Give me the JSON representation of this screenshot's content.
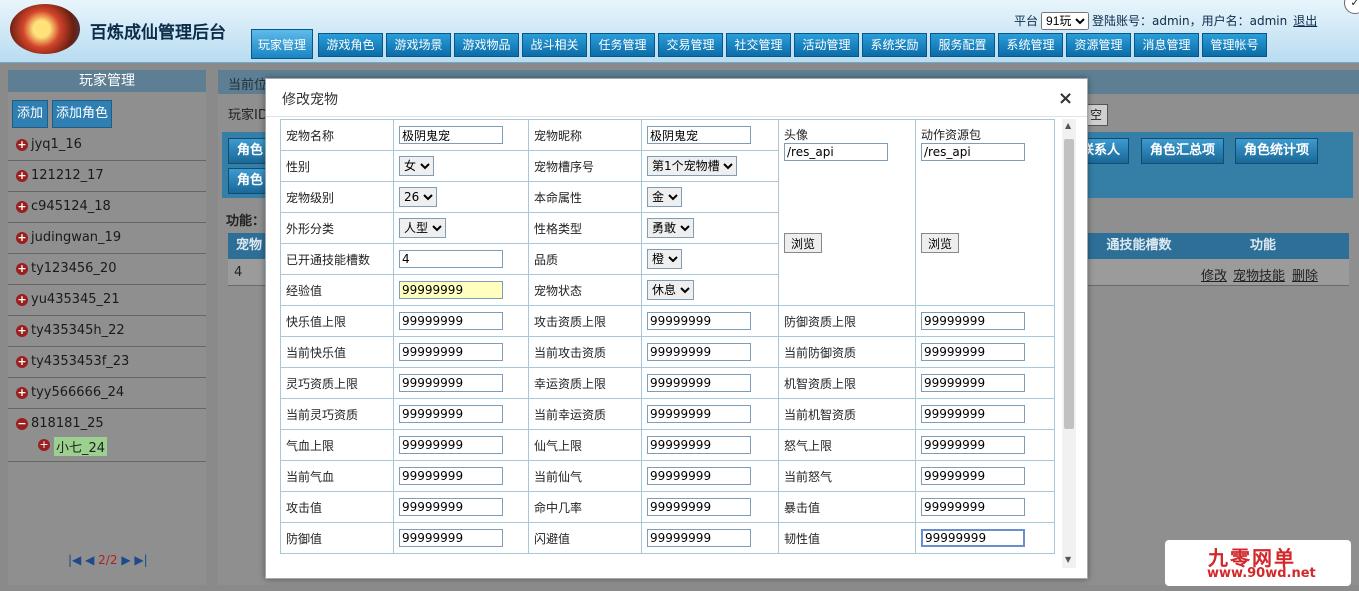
{
  "header": {
    "app_title": "百炼成仙管理后台",
    "platform_label": "平台",
    "platform_value": "91玩",
    "login_account_text": "登陆账号：admin，用户名：admin",
    "logout": "退出"
  },
  "nav": [
    {
      "label": "玩家管理",
      "active": true
    },
    {
      "label": "游戏角色"
    },
    {
      "label": "游戏场景"
    },
    {
      "label": "游戏物品"
    },
    {
      "label": "战斗相关"
    },
    {
      "label": "任务管理"
    },
    {
      "label": "交易管理"
    },
    {
      "label": "社交管理"
    },
    {
      "label": "活动管理"
    },
    {
      "label": "系统奖励"
    },
    {
      "label": "服务配置"
    },
    {
      "label": "系统管理"
    },
    {
      "label": "资源管理"
    },
    {
      "label": "消息管理"
    },
    {
      "label": "管理帐号"
    }
  ],
  "sidebar": {
    "title": "玩家管理",
    "add": "添加",
    "add_role": "添加角色",
    "players": [
      "jyq1_16",
      "121212_17",
      "c945124_18",
      "judingwan_19",
      "ty123456_20",
      "yu435345_21",
      "ty435345h_22",
      "ty4353453f_23",
      "tyy566666_24",
      "818181_25"
    ],
    "pet": "小七_24",
    "pager": "2/2"
  },
  "main": {
    "crumb": "当前位",
    "player_id_label": "玩家ID",
    "clear": "空",
    "tabs": [
      "角色",
      "联系人",
      "角色汇总项",
      "角色统计项",
      "角色"
    ],
    "func_label": "功能：",
    "table_headers": [
      "宠物",
      "通技能槽数",
      "功能"
    ],
    "row": {
      "id": "4",
      "edit": "修改",
      "pet_skill": "宠物技能",
      "delete": "删除"
    }
  },
  "modal": {
    "title": "修改宠物",
    "close": "×",
    "fields": {
      "pet_name_label": "宠物名称",
      "pet_name": "极阴鬼宠",
      "nickname_label": "宠物昵称",
      "nickname": "极阴鬼宠",
      "avatar_label": "头像",
      "avatar": "/res_api",
      "action_pack_label": "动作资源包",
      "action_pack": "/res_api",
      "browse": "浏览",
      "gender_label": "性别",
      "gender": "女",
      "slot_label": "宠物槽序号",
      "slot": "第1个宠物槽",
      "level_label": "宠物级别",
      "level": "26",
      "element_label": "本命属性",
      "element": "金",
      "shape_label": "外形分类",
      "shape": "人型",
      "character_label": "性格类型",
      "character": "勇敢",
      "skill_slots_label": "已开通技能槽数",
      "skill_slots": "4",
      "quality_label": "品质",
      "quality": "橙",
      "exp_label": "经验值",
      "exp": "99999999",
      "state_label": "宠物状态",
      "state": "休息"
    },
    "grid": [
      [
        "快乐值上限",
        "99999999",
        "攻击资质上限",
        "99999999",
        "防御资质上限",
        "99999999"
      ],
      [
        "当前快乐值",
        "99999999",
        "当前攻击资质",
        "99999999",
        "当前防御资质",
        "99999999"
      ],
      [
        "灵巧资质上限",
        "99999999",
        "幸运资质上限",
        "99999999",
        "机智资质上限",
        "99999999"
      ],
      [
        "当前灵巧资质",
        "99999999",
        "当前幸运资质",
        "99999999",
        "当前机智资质",
        "99999999"
      ],
      [
        "气血上限",
        "99999999",
        "仙气上限",
        "99999999",
        "怒气上限",
        "99999999"
      ],
      [
        "当前气血",
        "99999999",
        "当前仙气",
        "99999999",
        "当前怒气",
        "99999999"
      ],
      [
        "攻击值",
        "99999999",
        "命中几率",
        "99999999",
        "暴击值",
        "99999999"
      ],
      [
        "防御值",
        "99999999",
        "闪避值",
        "99999999",
        "韧性值",
        "99999999"
      ]
    ]
  },
  "watermark": {
    "name": "九零网单",
    "url": "www.90wd.net"
  }
}
